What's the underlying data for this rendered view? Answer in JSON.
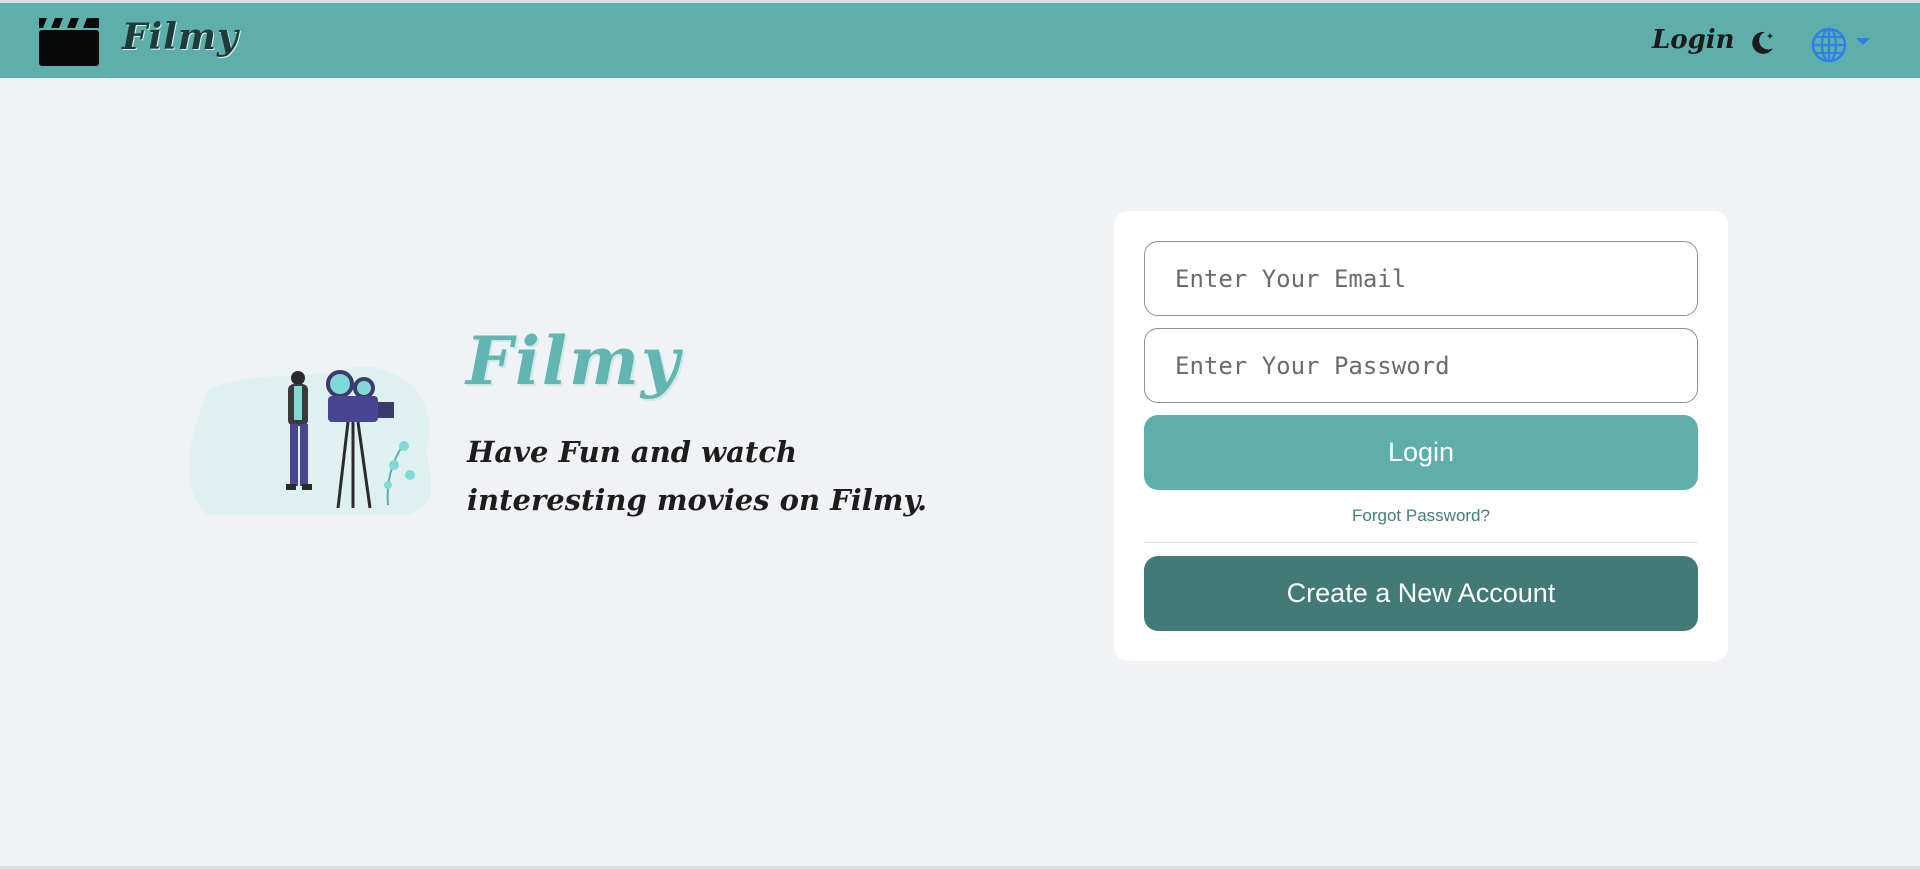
{
  "navbar": {
    "brand": "Filmy",
    "login_label": "Login",
    "icons": {
      "logo": "clapperboard-icon",
      "theme": "moon-icon",
      "language": "globe-icon",
      "dropdown": "caret-down-icon"
    },
    "background_color": "#5eaeab"
  },
  "hero": {
    "brand": "Filmy",
    "tagline": "Have Fun and watch interesting movies on Filmy.",
    "illustration": "cameraman-illustration"
  },
  "login_form": {
    "email_placeholder": "Enter Your Email",
    "password_placeholder": "Enter Your Password",
    "login_button": "Login",
    "forgot_password": "Forgot Password?",
    "create_account_button": "Create a New Account"
  },
  "colors": {
    "accent": "#5eaeab",
    "accent_dark": "#417a77",
    "page_background": "#f0f2f5",
    "globe": "#2f7fe8"
  }
}
